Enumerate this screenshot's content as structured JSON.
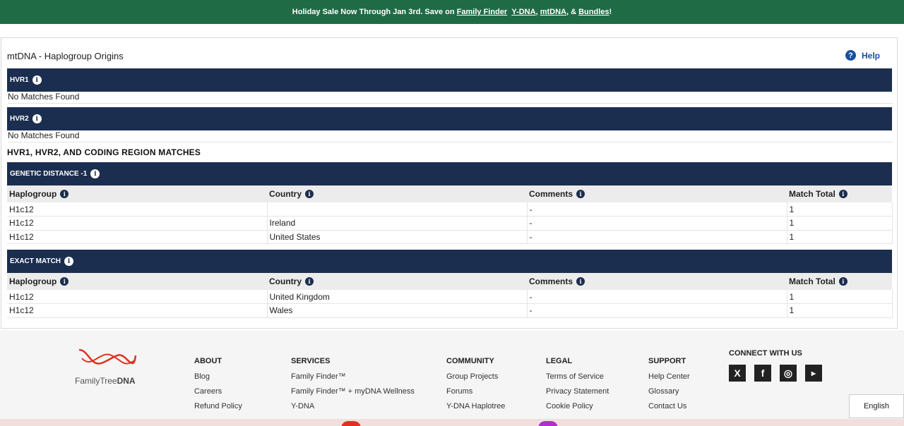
{
  "banner": {
    "lead": "Holiday Sale Now Through Jan 3rd. Save on ",
    "link1": "Family Finder",
    "link2": "Y-DNA",
    "comma": ",",
    "link3": "mtDNA",
    "amp": ", &",
    "link4": "Bundles",
    "bang": "!"
  },
  "page": {
    "title": "mtDNA - Haplogroup Origins",
    "help_label": "Help"
  },
  "hvr1": {
    "label": "HVR1",
    "message": "No Matches Found"
  },
  "hvr2": {
    "label": "HVR2",
    "message": "No Matches Found"
  },
  "coding_section": {
    "title": "HVR1, HVR2, AND CODING REGION MATCHES"
  },
  "columns": {
    "haplogroup": "Haplogroup",
    "country": "Country",
    "comments": "Comments",
    "match_total": "Match Total"
  },
  "genetic_distance": {
    "label": "GENETIC DISTANCE -1",
    "rows": [
      {
        "haplogroup": "H1c12",
        "country": "",
        "comments": "-",
        "match_total": "1"
      },
      {
        "haplogroup": "H1c12",
        "country": "Ireland",
        "comments": "-",
        "match_total": "1"
      },
      {
        "haplogroup": "H1c12",
        "country": "United States",
        "comments": "-",
        "match_total": "1"
      }
    ]
  },
  "exact_match": {
    "label": "EXACT MATCH",
    "rows": [
      {
        "haplogroup": "H1c12",
        "country": "United Kingdom",
        "comments": "-",
        "match_total": "1"
      },
      {
        "haplogroup": "H1c12",
        "country": "Wales",
        "comments": "-",
        "match_total": "1"
      }
    ]
  },
  "footer": {
    "logo_name": "FamilyTree",
    "logo_bold": "DNA",
    "about": {
      "title": "ABOUT",
      "links": [
        "Blog",
        "Careers",
        "Refund Policy"
      ]
    },
    "services": {
      "title": "SERVICES",
      "links": [
        "Family Finder™",
        "Family Finder™ + myDNA Wellness",
        "Y-DNA"
      ]
    },
    "community": {
      "title": "COMMUNITY",
      "links": [
        "Group Projects",
        "Forums",
        "Y-DNA Haplotree"
      ]
    },
    "legal": {
      "title": "LEGAL",
      "links": [
        "Terms of Service",
        "Privacy Statement",
        "Cookie Policy"
      ]
    },
    "support": {
      "title": "SUPPORT",
      "links": [
        "Help Center",
        "Glossary",
        "Contact Us"
      ]
    },
    "connect": {
      "title": "CONNECT WITH US"
    },
    "language": "English"
  },
  "colors": {
    "banner": "#1f6b45",
    "header_bar": "#1c2e4f",
    "link_blue": "#1a4fa0",
    "logo_red": "#e0301e"
  }
}
